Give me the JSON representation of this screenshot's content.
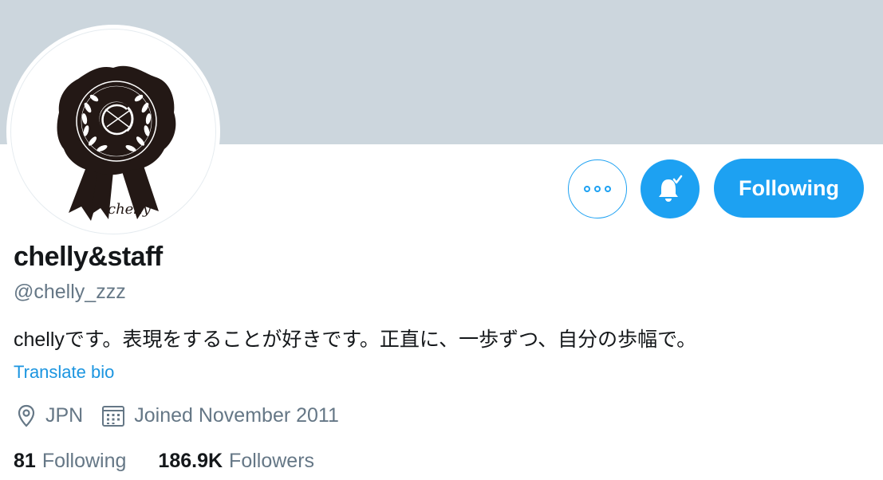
{
  "profile": {
    "display_name": "chelly&staff",
    "handle": "@chelly_zzz",
    "bio": "chellyです。表現をすることが好きです。正直に、一歩ずつ、自分の歩幅で。",
    "translate_label": "Translate bio",
    "location": "JPN",
    "joined": "Joined November 2011",
    "avatar_signature": "chelly"
  },
  "actions": {
    "more_icon": "more-dots-icon",
    "bell_icon": "bell-check-icon",
    "follow_label": "Following"
  },
  "stats": {
    "following_count": "81",
    "following_label": "Following",
    "followers_count": "186.9K",
    "followers_label": "Followers"
  },
  "colors": {
    "banner": "#ccd6dd",
    "accent": "#1da1f2",
    "link": "#1b95e0",
    "secondary_text": "#657786"
  }
}
